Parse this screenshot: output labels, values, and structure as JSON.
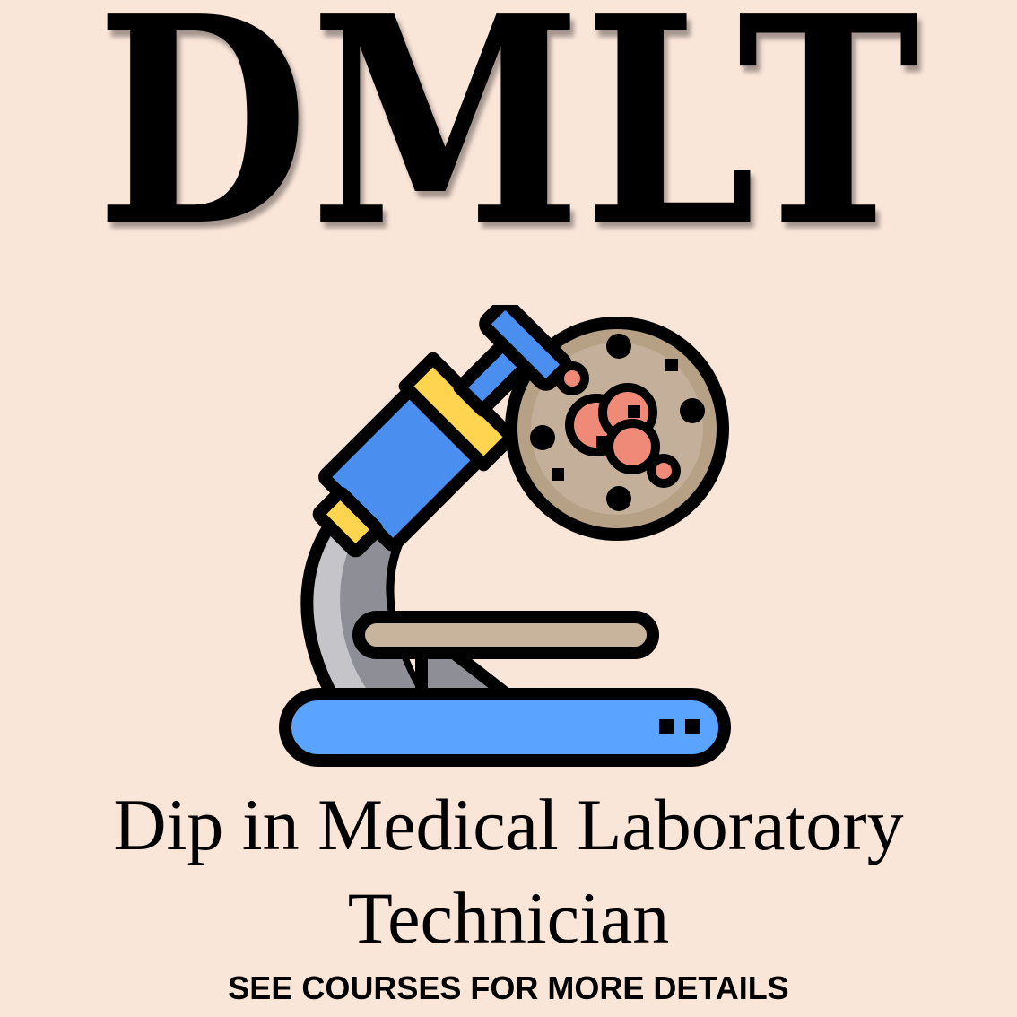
{
  "title": "DMLT",
  "subtitle": {
    "line1": "Dip in Medical Laboratory",
    "line2": "Technician"
  },
  "footer": "SEE COURSES FOR MORE DETAILS",
  "illustration": {
    "icon": "microscope-icon",
    "sample_icon": "petri-dish-icon"
  },
  "colors": {
    "background": "#fae5d9",
    "text": "#000000",
    "tube_blue": "#4a8ff0",
    "accent_yellow": "#ffd54f",
    "arm_gray": "#c4c4c9",
    "dish_brown": "#b6a086",
    "cell_salmon": "#f08a78"
  }
}
